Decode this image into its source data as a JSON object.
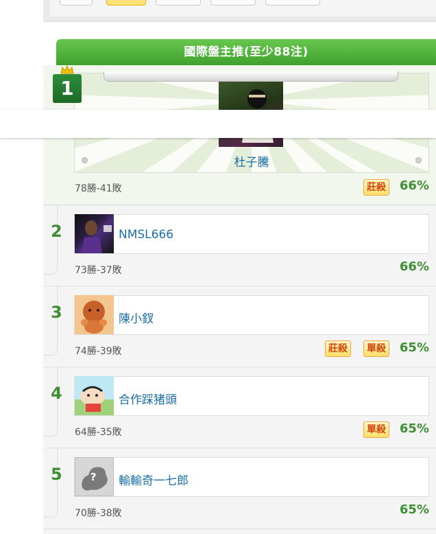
{
  "section_title": "國際盤主推(至少88注)",
  "colors": {
    "accent_green": "#3fa12e",
    "rank_green": "#3f8f34",
    "name_blue": "#1a6ea5",
    "tag_text": "#d34a10"
  },
  "top_pick": {
    "rank": "1",
    "name": "杜子騰",
    "record": "78勝-41敗",
    "tags": [
      "莊殺"
    ],
    "win_rate": "66%"
  },
  "rows": [
    {
      "rank": "2",
      "name": "NMSL666",
      "record": "73勝-37敗",
      "tags": [],
      "win_rate": "66%"
    },
    {
      "rank": "3",
      "name": "陳小釵",
      "record": "74勝-39敗",
      "tags": [
        "莊殺",
        "單殺"
      ],
      "win_rate": "65%"
    },
    {
      "rank": "4",
      "name": "合作踩猪頭",
      "record": "64勝-35敗",
      "tags": [
        "單殺"
      ],
      "win_rate": "65%"
    },
    {
      "rank": "5",
      "name": "輸輸奇一七郎",
      "record": "70勝-38敗",
      "tags": [],
      "win_rate": "65%"
    }
  ],
  "icons": {
    "crown": "crown-icon",
    "default_avatar": "question-avatar-icon"
  }
}
